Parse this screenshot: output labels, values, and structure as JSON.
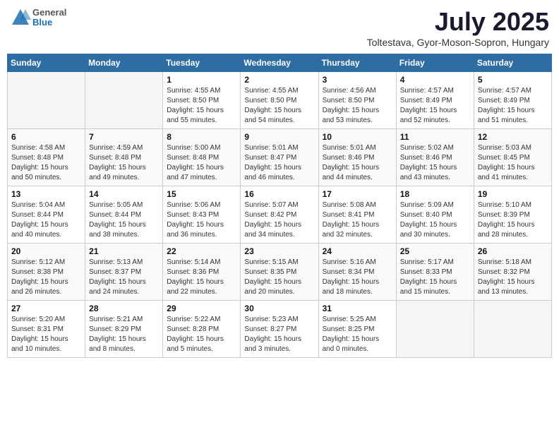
{
  "header": {
    "logo": {
      "general": "General",
      "blue": "Blue"
    },
    "title": "July 2025",
    "subtitle": "Toltestava, Gyor-Moson-Sopron, Hungary"
  },
  "weekdays": [
    "Sunday",
    "Monday",
    "Tuesday",
    "Wednesday",
    "Thursday",
    "Friday",
    "Saturday"
  ],
  "weeks": [
    [
      {
        "day": "",
        "sunrise": "",
        "sunset": "",
        "daylight": ""
      },
      {
        "day": "",
        "sunrise": "",
        "sunset": "",
        "daylight": ""
      },
      {
        "day": "1",
        "sunrise": "Sunrise: 4:55 AM",
        "sunset": "Sunset: 8:50 PM",
        "daylight": "Daylight: 15 hours and 55 minutes."
      },
      {
        "day": "2",
        "sunrise": "Sunrise: 4:55 AM",
        "sunset": "Sunset: 8:50 PM",
        "daylight": "Daylight: 15 hours and 54 minutes."
      },
      {
        "day": "3",
        "sunrise": "Sunrise: 4:56 AM",
        "sunset": "Sunset: 8:50 PM",
        "daylight": "Daylight: 15 hours and 53 minutes."
      },
      {
        "day": "4",
        "sunrise": "Sunrise: 4:57 AM",
        "sunset": "Sunset: 8:49 PM",
        "daylight": "Daylight: 15 hours and 52 minutes."
      },
      {
        "day": "5",
        "sunrise": "Sunrise: 4:57 AM",
        "sunset": "Sunset: 8:49 PM",
        "daylight": "Daylight: 15 hours and 51 minutes."
      }
    ],
    [
      {
        "day": "6",
        "sunrise": "Sunrise: 4:58 AM",
        "sunset": "Sunset: 8:48 PM",
        "daylight": "Daylight: 15 hours and 50 minutes."
      },
      {
        "day": "7",
        "sunrise": "Sunrise: 4:59 AM",
        "sunset": "Sunset: 8:48 PM",
        "daylight": "Daylight: 15 hours and 49 minutes."
      },
      {
        "day": "8",
        "sunrise": "Sunrise: 5:00 AM",
        "sunset": "Sunset: 8:48 PM",
        "daylight": "Daylight: 15 hours and 47 minutes."
      },
      {
        "day": "9",
        "sunrise": "Sunrise: 5:01 AM",
        "sunset": "Sunset: 8:47 PM",
        "daylight": "Daylight: 15 hours and 46 minutes."
      },
      {
        "day": "10",
        "sunrise": "Sunrise: 5:01 AM",
        "sunset": "Sunset: 8:46 PM",
        "daylight": "Daylight: 15 hours and 44 minutes."
      },
      {
        "day": "11",
        "sunrise": "Sunrise: 5:02 AM",
        "sunset": "Sunset: 8:46 PM",
        "daylight": "Daylight: 15 hours and 43 minutes."
      },
      {
        "day": "12",
        "sunrise": "Sunrise: 5:03 AM",
        "sunset": "Sunset: 8:45 PM",
        "daylight": "Daylight: 15 hours and 41 minutes."
      }
    ],
    [
      {
        "day": "13",
        "sunrise": "Sunrise: 5:04 AM",
        "sunset": "Sunset: 8:44 PM",
        "daylight": "Daylight: 15 hours and 40 minutes."
      },
      {
        "day": "14",
        "sunrise": "Sunrise: 5:05 AM",
        "sunset": "Sunset: 8:44 PM",
        "daylight": "Daylight: 15 hours and 38 minutes."
      },
      {
        "day": "15",
        "sunrise": "Sunrise: 5:06 AM",
        "sunset": "Sunset: 8:43 PM",
        "daylight": "Daylight: 15 hours and 36 minutes."
      },
      {
        "day": "16",
        "sunrise": "Sunrise: 5:07 AM",
        "sunset": "Sunset: 8:42 PM",
        "daylight": "Daylight: 15 hours and 34 minutes."
      },
      {
        "day": "17",
        "sunrise": "Sunrise: 5:08 AM",
        "sunset": "Sunset: 8:41 PM",
        "daylight": "Daylight: 15 hours and 32 minutes."
      },
      {
        "day": "18",
        "sunrise": "Sunrise: 5:09 AM",
        "sunset": "Sunset: 8:40 PM",
        "daylight": "Daylight: 15 hours and 30 minutes."
      },
      {
        "day": "19",
        "sunrise": "Sunrise: 5:10 AM",
        "sunset": "Sunset: 8:39 PM",
        "daylight": "Daylight: 15 hours and 28 minutes."
      }
    ],
    [
      {
        "day": "20",
        "sunrise": "Sunrise: 5:12 AM",
        "sunset": "Sunset: 8:38 PM",
        "daylight": "Daylight: 15 hours and 26 minutes."
      },
      {
        "day": "21",
        "sunrise": "Sunrise: 5:13 AM",
        "sunset": "Sunset: 8:37 PM",
        "daylight": "Daylight: 15 hours and 24 minutes."
      },
      {
        "day": "22",
        "sunrise": "Sunrise: 5:14 AM",
        "sunset": "Sunset: 8:36 PM",
        "daylight": "Daylight: 15 hours and 22 minutes."
      },
      {
        "day": "23",
        "sunrise": "Sunrise: 5:15 AM",
        "sunset": "Sunset: 8:35 PM",
        "daylight": "Daylight: 15 hours and 20 minutes."
      },
      {
        "day": "24",
        "sunrise": "Sunrise: 5:16 AM",
        "sunset": "Sunset: 8:34 PM",
        "daylight": "Daylight: 15 hours and 18 minutes."
      },
      {
        "day": "25",
        "sunrise": "Sunrise: 5:17 AM",
        "sunset": "Sunset: 8:33 PM",
        "daylight": "Daylight: 15 hours and 15 minutes."
      },
      {
        "day": "26",
        "sunrise": "Sunrise: 5:18 AM",
        "sunset": "Sunset: 8:32 PM",
        "daylight": "Daylight: 15 hours and 13 minutes."
      }
    ],
    [
      {
        "day": "27",
        "sunrise": "Sunrise: 5:20 AM",
        "sunset": "Sunset: 8:31 PM",
        "daylight": "Daylight: 15 hours and 10 minutes."
      },
      {
        "day": "28",
        "sunrise": "Sunrise: 5:21 AM",
        "sunset": "Sunset: 8:29 PM",
        "daylight": "Daylight: 15 hours and 8 minutes."
      },
      {
        "day": "29",
        "sunrise": "Sunrise: 5:22 AM",
        "sunset": "Sunset: 8:28 PM",
        "daylight": "Daylight: 15 hours and 5 minutes."
      },
      {
        "day": "30",
        "sunrise": "Sunrise: 5:23 AM",
        "sunset": "Sunset: 8:27 PM",
        "daylight": "Daylight: 15 hours and 3 minutes."
      },
      {
        "day": "31",
        "sunrise": "Sunrise: 5:25 AM",
        "sunset": "Sunset: 8:25 PM",
        "daylight": "Daylight: 15 hours and 0 minutes."
      },
      {
        "day": "",
        "sunrise": "",
        "sunset": "",
        "daylight": ""
      },
      {
        "day": "",
        "sunrise": "",
        "sunset": "",
        "daylight": ""
      }
    ]
  ]
}
